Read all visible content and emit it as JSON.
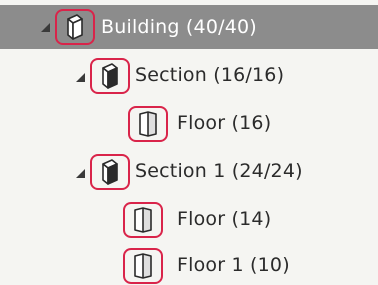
{
  "tree": {
    "nodes": [
      {
        "id": "building",
        "label": "Building (40/40)",
        "icon": "building-icon",
        "expanded": true,
        "selected": true
      },
      {
        "id": "section",
        "label": "Section (16/16)",
        "icon": "section-icon",
        "expanded": true,
        "selected": false
      },
      {
        "id": "floor",
        "label": "Floor (16)",
        "icon": "floor-icon",
        "expanded": false,
        "selected": false
      },
      {
        "id": "section-1",
        "label": "Section 1 (24/24)",
        "icon": "section-icon",
        "expanded": true,
        "selected": false
      },
      {
        "id": "floor-a",
        "label": "Floor (14)",
        "icon": "floor-icon",
        "expanded": false,
        "selected": false
      },
      {
        "id": "floor-1",
        "label": "Floor 1 (10)",
        "icon": "floor-icon",
        "expanded": false,
        "selected": false
      }
    ]
  },
  "colors": {
    "background": "#f5f5f2",
    "selected_row": "#8c8c8c",
    "highlight_border": "#d9244a",
    "text": "#2b2b2b"
  }
}
